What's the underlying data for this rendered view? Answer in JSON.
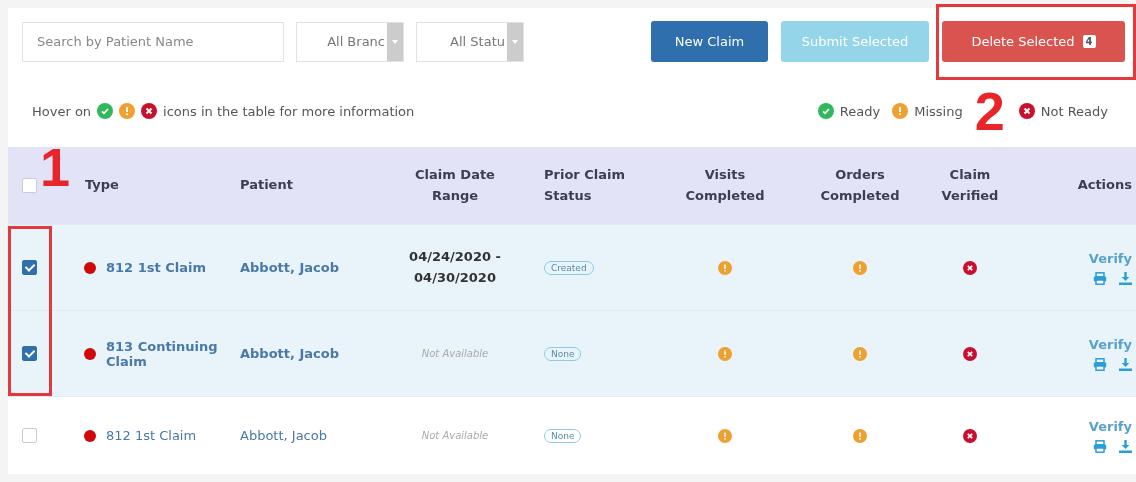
{
  "toolbar": {
    "search": {
      "placeholder": "Search by Patient Name"
    },
    "filters": [
      {
        "value": "All Branc"
      },
      {
        "value": "All Statu"
      }
    ],
    "buttons": [
      {
        "label": "New Claim",
        "kind": "primary",
        "disabled": false
      },
      {
        "label": "Submit Selected",
        "kind": "info",
        "disabled": true
      },
      {
        "label": "Delete Selected",
        "kind": "danger",
        "disabled": false,
        "badge": "4"
      }
    ]
  },
  "hint": {
    "before": "Hover on",
    "after": "icons in the table for more information",
    "icons": [
      {
        "kind": "ready"
      },
      {
        "kind": "missing"
      },
      {
        "kind": "not_ready"
      }
    ]
  },
  "legend": [
    {
      "kind": "ready",
      "label": "Ready"
    },
    {
      "kind": "missing",
      "label": "Missing"
    },
    {
      "kind": "not_ready",
      "label": "Not Ready"
    }
  ],
  "table": {
    "select_all": {
      "checked": false
    },
    "columns": [
      "Type",
      "Patient",
      "Claim Date Range",
      "Prior Claim Status",
      "Visits Completed",
      "Orders Completed",
      "Claim Verified",
      "Actions"
    ],
    "rows": [
      {
        "checked": true,
        "color": "#d00a0a",
        "type": "812 1st Claim",
        "patient": "Abbott, Jacob",
        "date_range": {
          "available": true,
          "text": "04/24/2020 - 04/30/2020"
        },
        "prior_status": "Created",
        "visits": {
          "kind": "missing"
        },
        "orders": {
          "kind": "missing"
        },
        "verified": {
          "kind": "not_ready"
        },
        "action": "Verify"
      },
      {
        "checked": true,
        "color": "#d00a0a",
        "type": "813 Continuing Claim",
        "patient": "Abbott, Jacob",
        "date_range": {
          "available": false,
          "text": "Not Available"
        },
        "prior_status": "None",
        "visits": {
          "kind": "missing"
        },
        "orders": {
          "kind": "missing"
        },
        "verified": {
          "kind": "not_ready"
        },
        "action": "Verify"
      },
      {
        "checked": false,
        "color": "#d00a0a",
        "type": "812 1st Claim",
        "patient": "Abbott, Jacob",
        "date_range": {
          "available": false,
          "text": "Not Available"
        },
        "prior_status": "None",
        "visits": {
          "kind": "missing"
        },
        "orders": {
          "kind": "missing"
        },
        "verified": {
          "kind": "not_ready"
        },
        "action": "Verify"
      }
    ]
  },
  "annotations": [
    {
      "label": "1",
      "kind": "checkboxes"
    },
    {
      "label": "2",
      "kind": "delete"
    }
  ]
}
